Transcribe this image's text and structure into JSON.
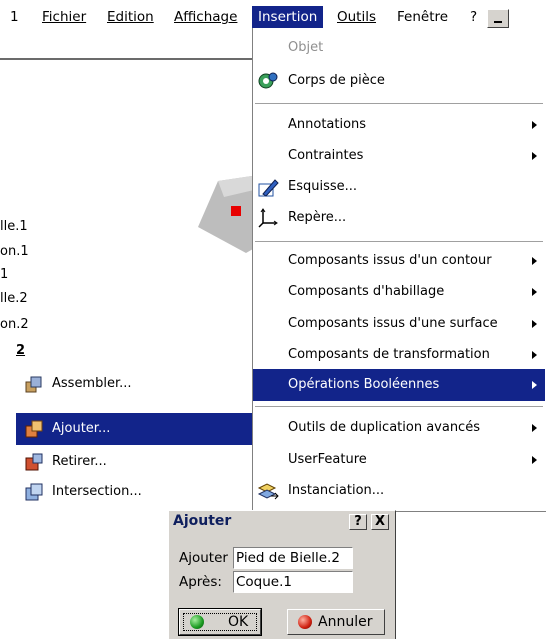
{
  "menubar": {
    "items": [
      {
        "label": "1"
      },
      {
        "label": "Fichier"
      },
      {
        "label": "Edition"
      },
      {
        "label": "Affichage"
      },
      {
        "label": "Insertion"
      },
      {
        "label": "Outils"
      },
      {
        "label": "Fenêtre"
      },
      {
        "label": "?"
      }
    ]
  },
  "tree": {
    "items": [
      "lle.1",
      "on.1",
      "1",
      "lle.2",
      "on.2",
      "2"
    ]
  },
  "menu": {
    "items": [
      {
        "label": "Objet",
        "icon": "none"
      },
      {
        "label": "Corps de pièce",
        "icon": "gear-body-icon"
      },
      {
        "label": "Annotations"
      },
      {
        "label": "Contraintes"
      },
      {
        "label": "Esquisse...",
        "icon": "sketch-icon"
      },
      {
        "label": "Repère...",
        "icon": "axis-icon"
      },
      {
        "label": "Composants issus d'un contour"
      },
      {
        "label": "Composants d'habillage"
      },
      {
        "label": "Composants issus d'une surface"
      },
      {
        "label": "Composants de transformation"
      },
      {
        "label": "Opérations Booléennes"
      },
      {
        "label": "Outils de duplication avancés"
      },
      {
        "label": "UserFeature"
      },
      {
        "label": "Instanciation...",
        "icon": "instantiate-icon"
      }
    ]
  },
  "submenu": {
    "items": [
      {
        "label": "Assembler...",
        "icon": "assemble-icon"
      },
      {
        "label": "Ajouter...",
        "icon": "add-icon"
      },
      {
        "label": "Retirer...",
        "icon": "remove-icon"
      },
      {
        "label": "Intersection...",
        "icon": "intersect-icon"
      }
    ]
  },
  "dialog": {
    "title": "Ajouter",
    "help_label": "?",
    "close_label": "X",
    "field1_label": "Ajouter",
    "field1_value": "Pied de Bielle.2",
    "field2_label": "Après:",
    "field2_value": "Coque.1",
    "ok_label": "OK",
    "cancel_label": "Annuler"
  },
  "colors": {
    "highlight": "#12248a",
    "face": "#d6d3ce"
  }
}
